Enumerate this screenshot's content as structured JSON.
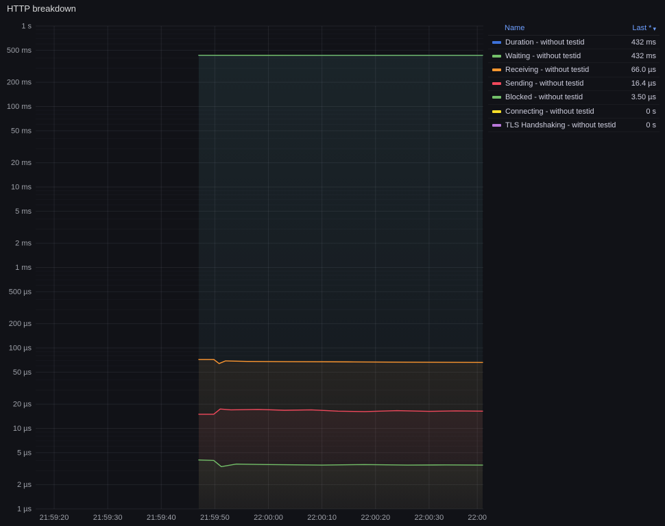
{
  "panel": {
    "title": "HTTP breakdown"
  },
  "colors": {
    "background": "#111217",
    "grid": "#CCCCDC",
    "axis_text": "#9DA0A8",
    "legend_header": "#6E9FFF",
    "legend_text": "#CCCCDC"
  },
  "legend": {
    "columns": {
      "name": "Name",
      "value": "Last *",
      "sort_glyph": "▾"
    },
    "rows": [
      {
        "name": "Duration - without testid",
        "value": "432 ms",
        "color": "#3D71D9"
      },
      {
        "name": "Waiting - without testid",
        "value": "432 ms",
        "color": "#73BF69"
      },
      {
        "name": "Receiving - without testid",
        "value": "66.0 µs",
        "color": "#FF9830"
      },
      {
        "name": "Sending - without testid",
        "value": "16.4 µs",
        "color": "#F2495C"
      },
      {
        "name": "Blocked - without testid",
        "value": "3.50 µs",
        "color": "#73BF69"
      },
      {
        "name": "Connecting - without testid",
        "value": "0 s",
        "color": "#FADE2A"
      },
      {
        "name": "TLS Handshaking - without testid",
        "value": "0 s",
        "color": "#B877D9"
      }
    ]
  },
  "chart_data": {
    "type": "line",
    "title": "HTTP breakdown",
    "xlabel": "",
    "ylabel": "",
    "legend_position": "right-table",
    "grid": true,
    "y_axis": {
      "scale": "log10",
      "unit": "seconds",
      "min": 1e-06,
      "max": 1,
      "ticks": [
        {
          "label": "1 s",
          "v": 1
        },
        {
          "label": "500 ms",
          "v": 0.5
        },
        {
          "label": "200 ms",
          "v": 0.2
        },
        {
          "label": "100 ms",
          "v": 0.1
        },
        {
          "label": "50 ms",
          "v": 0.05
        },
        {
          "label": "20 ms",
          "v": 0.02
        },
        {
          "label": "10 ms",
          "v": 0.01
        },
        {
          "label": "5 ms",
          "v": 0.005
        },
        {
          "label": "2 ms",
          "v": 0.002
        },
        {
          "label": "1 ms",
          "v": 0.001
        },
        {
          "label": "500 µs",
          "v": 0.0005
        },
        {
          "label": "200 µs",
          "v": 0.0002
        },
        {
          "label": "100 µs",
          "v": 0.0001
        },
        {
          "label": "50 µs",
          "v": 5e-05
        },
        {
          "label": "20 µs",
          "v": 2e-05
        },
        {
          "label": "10 µs",
          "v": 1e-05
        },
        {
          "label": "5 µs",
          "v": 5e-06
        },
        {
          "label": "2 µs",
          "v": 2e-06
        },
        {
          "label": "1 µs",
          "v": 1e-06
        }
      ]
    },
    "x_axis": {
      "unit": "time-of-day, seconds offset from 21:59:20",
      "ticks": [
        {
          "label": "21:59:20",
          "t": 0
        },
        {
          "label": "21:59:30",
          "t": 10
        },
        {
          "label": "21:59:40",
          "t": 20
        },
        {
          "label": "21:59:50",
          "t": 30
        },
        {
          "label": "22:00:00",
          "t": 40
        },
        {
          "label": "22:00:10",
          "t": 50
        },
        {
          "label": "22:00:20",
          "t": 60
        },
        {
          "label": "22:00:30",
          "t": 70
        },
        {
          "label": "22:00",
          "t": 79
        }
      ]
    },
    "series": [
      {
        "name": "Duration - without testid",
        "color": "#3D71D9",
        "last": "432 ms",
        "points": [
          [
            27,
            0.433
          ],
          [
            50,
            0.432
          ],
          [
            80,
            0.432
          ]
        ]
      },
      {
        "name": "Waiting - without testid",
        "color": "#73BF69",
        "last": "432 ms",
        "points": [
          [
            27,
            0.433
          ],
          [
            50,
            0.432
          ],
          [
            80,
            0.432
          ]
        ]
      },
      {
        "name": "Receiving - without testid",
        "color": "#FF9830",
        "last": "66.0 µs",
        "points": [
          [
            27,
            7.2e-05
          ],
          [
            29.8,
            7.2e-05
          ],
          [
            30.8,
            6.4e-05
          ],
          [
            32,
            6.9e-05
          ],
          [
            36,
            6.8e-05
          ],
          [
            44,
            6.75e-05
          ],
          [
            56,
            6.7e-05
          ],
          [
            66,
            6.65e-05
          ],
          [
            80,
            6.6e-05
          ]
        ]
      },
      {
        "name": "Sending - without testid",
        "color": "#F2495C",
        "last": "16.4 µs",
        "points": [
          [
            27,
            1.5e-05
          ],
          [
            29.8,
            1.5e-05
          ],
          [
            31,
            1.74e-05
          ],
          [
            33,
            1.7e-05
          ],
          [
            38,
            1.72e-05
          ],
          [
            43,
            1.68e-05
          ],
          [
            48,
            1.7e-05
          ],
          [
            53,
            1.64e-05
          ],
          [
            58,
            1.62e-05
          ],
          [
            64,
            1.66e-05
          ],
          [
            70,
            1.63e-05
          ],
          [
            75,
            1.65e-05
          ],
          [
            80,
            1.64e-05
          ]
        ]
      },
      {
        "name": "Blocked - without testid",
        "color": "#73BF69",
        "last": "3.50 µs",
        "points": [
          [
            27,
            4.05e-06
          ],
          [
            29.8,
            4e-06
          ],
          [
            31.2,
            3.35e-06
          ],
          [
            34,
            3.6e-06
          ],
          [
            40,
            3.55e-06
          ],
          [
            50,
            3.5e-06
          ],
          [
            58,
            3.55e-06
          ],
          [
            66,
            3.5e-06
          ],
          [
            73,
            3.52e-06
          ],
          [
            80,
            3.5e-06
          ]
        ]
      },
      {
        "name": "Connecting - without testid",
        "color": "#FADE2A",
        "last": "0 s",
        "points": []
      },
      {
        "name": "TLS Handshaking - without testid",
        "color": "#B877D9",
        "last": "0 s",
        "points": []
      }
    ]
  }
}
